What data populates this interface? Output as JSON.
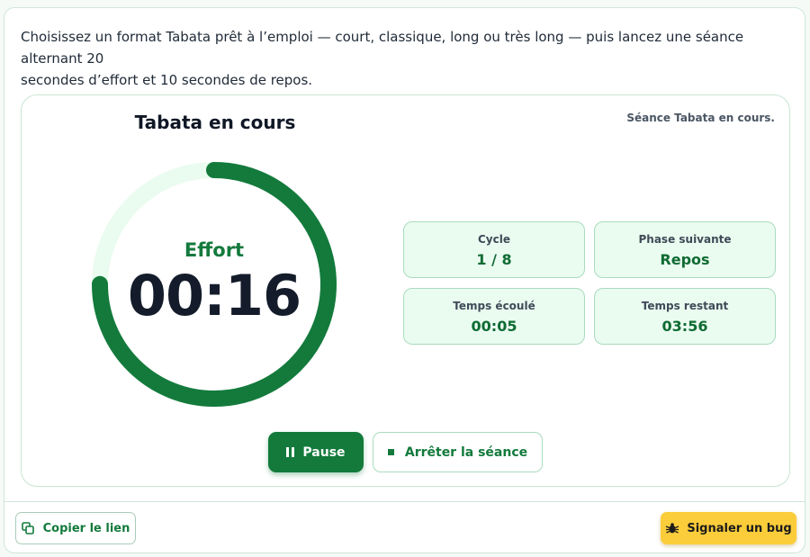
{
  "intro": {
    "line1": "Choisissez un format Tabata prêt à l’emploi — court, classique, long ou très long — puis lancez une séance alternant 20",
    "line2": "secondes d’effort et 10 secondes de repos."
  },
  "session": {
    "title": "Tabata en cours",
    "status": "Séance Tabata en cours.",
    "phase": "Effort",
    "time": "00:16",
    "phase_progress": 0.75,
    "colors": {
      "ring_progress": "#137a3c",
      "ring_track": "#eafbf0",
      "accent": "#137a3c"
    }
  },
  "stats": [
    {
      "label": "Cycle",
      "value": "1 / 8"
    },
    {
      "label": "Phase suivante",
      "value": "Repos"
    },
    {
      "label": "Temps écoulé",
      "value": "00:05"
    },
    {
      "label": "Temps restant",
      "value": "03:56"
    }
  ],
  "controls": {
    "pause_label": "Pause",
    "pause_icon": "pause-icon",
    "stop_label": "Arrêter la séance",
    "stop_icon": "stop-icon"
  },
  "footer": {
    "copy_label": "Copier le lien",
    "copy_icon": "copy-icon",
    "bug_label": "Signaler un bug",
    "bug_icon": "bug-icon",
    "bug_color": "#fbcd3a"
  }
}
